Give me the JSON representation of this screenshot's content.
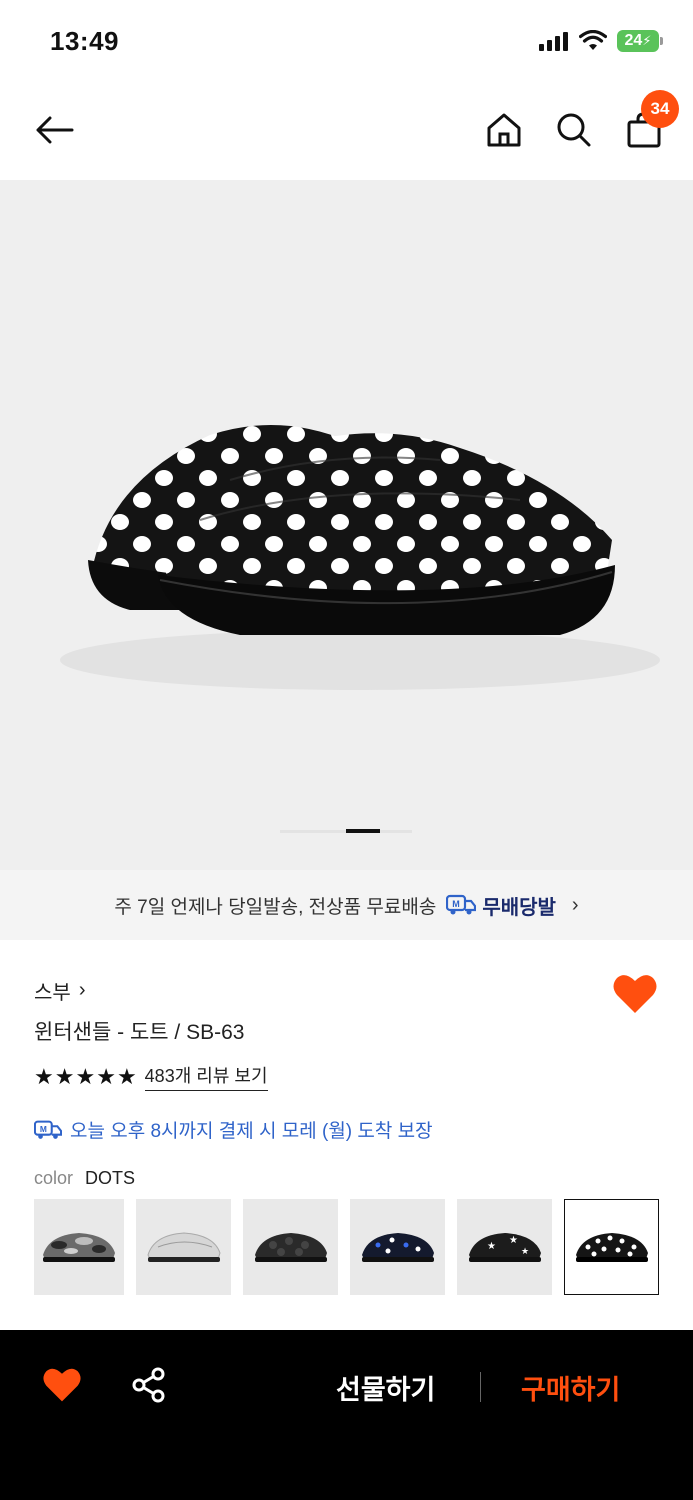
{
  "status_bar": {
    "time": "13:49",
    "battery": "24"
  },
  "header": {
    "back_icon": "arrow-left-icon",
    "home_icon": "home-icon",
    "search_icon": "search-icon",
    "cart_icon": "shopping-bag-icon",
    "cart_count": "34"
  },
  "colors": {
    "accent": "#ff4f0f",
    "link_blue": "#2f63c9",
    "brand_navy": "#1a2a6c"
  },
  "hero": {
    "slide_index": 3,
    "slide_count": 4
  },
  "shipping_banner": {
    "text": "주 7일 언제나 당일발송, 전상품 무료배송",
    "brand": "무배당발"
  },
  "product": {
    "brand": "스부",
    "name": "윈터샌들 - 도트 / SB-63",
    "rating_stars": 5,
    "review_link": "483개 리뷰 보기",
    "delivery_notice": "오늘 오후 8시까지 결제 시 모레 (월) 도착 보장",
    "color_label": "color",
    "color_value": "DOTS",
    "options": [
      "camo",
      "silver",
      "black-dots-dark",
      "navy-dots",
      "star",
      "dots"
    ],
    "selected_option": 5
  },
  "bottom_bar": {
    "gift_label": "선물하기",
    "buy_label": "구매하기"
  }
}
